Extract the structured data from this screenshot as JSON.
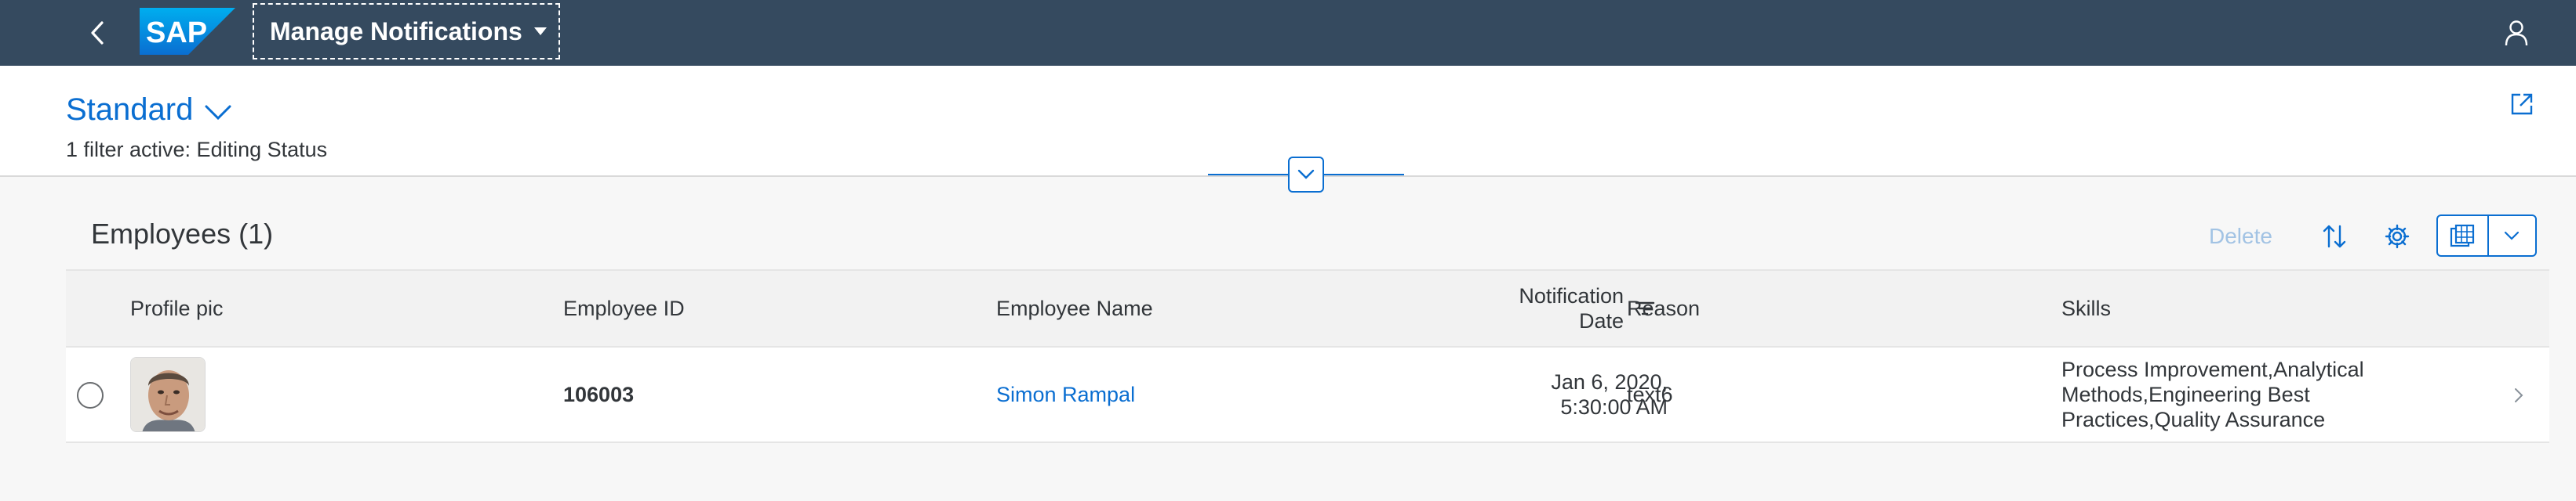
{
  "shell": {
    "app_title": "Manage Notifications",
    "logo_text": "SAP",
    "colors": {
      "shell_bg": "#354a5f",
      "logo_blue": "#1873b4"
    }
  },
  "header": {
    "variant_name": "Standard",
    "filter_info": "1 filter active: Editing Status"
  },
  "table": {
    "title": "Employees (1)",
    "toolbar": {
      "delete_label": "Delete",
      "icons": [
        "sort-icon",
        "settings-icon",
        "export-icon",
        "chevron-down-icon"
      ]
    },
    "columns": {
      "profile_pic": "Profile pic",
      "employee_id": "Employee ID",
      "employee_name": "Employee Name",
      "notification_date_line1": "Notification",
      "notification_date_line2": "Date",
      "reason": "Reason",
      "skills": "Skills"
    },
    "rows": [
      {
        "employee_id": "106003",
        "employee_name": "Simon Rampal",
        "notification_date_line1": "Jan 6, 2020,",
        "notification_date_line2": "5:30:00 AM",
        "reason": "text6",
        "skills_line1": "Process Improvement,Analytical",
        "skills_line2": "Methods,Engineering Best",
        "skills_line3": "Practices,Quality Assurance"
      }
    ]
  },
  "colors": {
    "accent": "#0a6ed1",
    "disabled_text": "#a2c3e4",
    "text": "#32363a",
    "page_bg": "#f7f7f7",
    "header_row_bg": "#f2f2f2"
  }
}
